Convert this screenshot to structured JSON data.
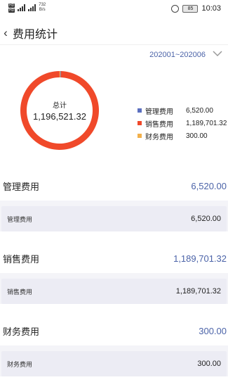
{
  "status_bar": {
    "network_speed": "732",
    "network_unit": "B/s",
    "battery": "85",
    "time": "10:03"
  },
  "header": {
    "title": "费用统计"
  },
  "filter": {
    "date_range": "202001~202006"
  },
  "chart_data": {
    "type": "pie",
    "center_label": "总计",
    "center_value": "1,196,521.32",
    "slices": [
      {
        "name": "管理费用",
        "value": 6520.0,
        "display": "6,520.00",
        "color": "#5b6fbf"
      },
      {
        "name": "销售费用",
        "value": 1189701.32,
        "display": "1,189,701.32",
        "color": "#f0492a"
      },
      {
        "name": "财务费用",
        "value": 300.0,
        "display": "300.00",
        "color": "#f2b04b"
      }
    ],
    "legend_placement": "right"
  },
  "sections": [
    {
      "name": "管理费用",
      "total": "6,520.00",
      "row_name": "管理费用",
      "row_value": "6,520.00"
    },
    {
      "name": "销售费用",
      "total": "1,189,701.32",
      "row_name": "销售费用",
      "row_value": "1,189,701.32"
    },
    {
      "name": "财务费用",
      "total": "300.00",
      "row_name": "财务费用",
      "row_value": "300.00"
    }
  ]
}
